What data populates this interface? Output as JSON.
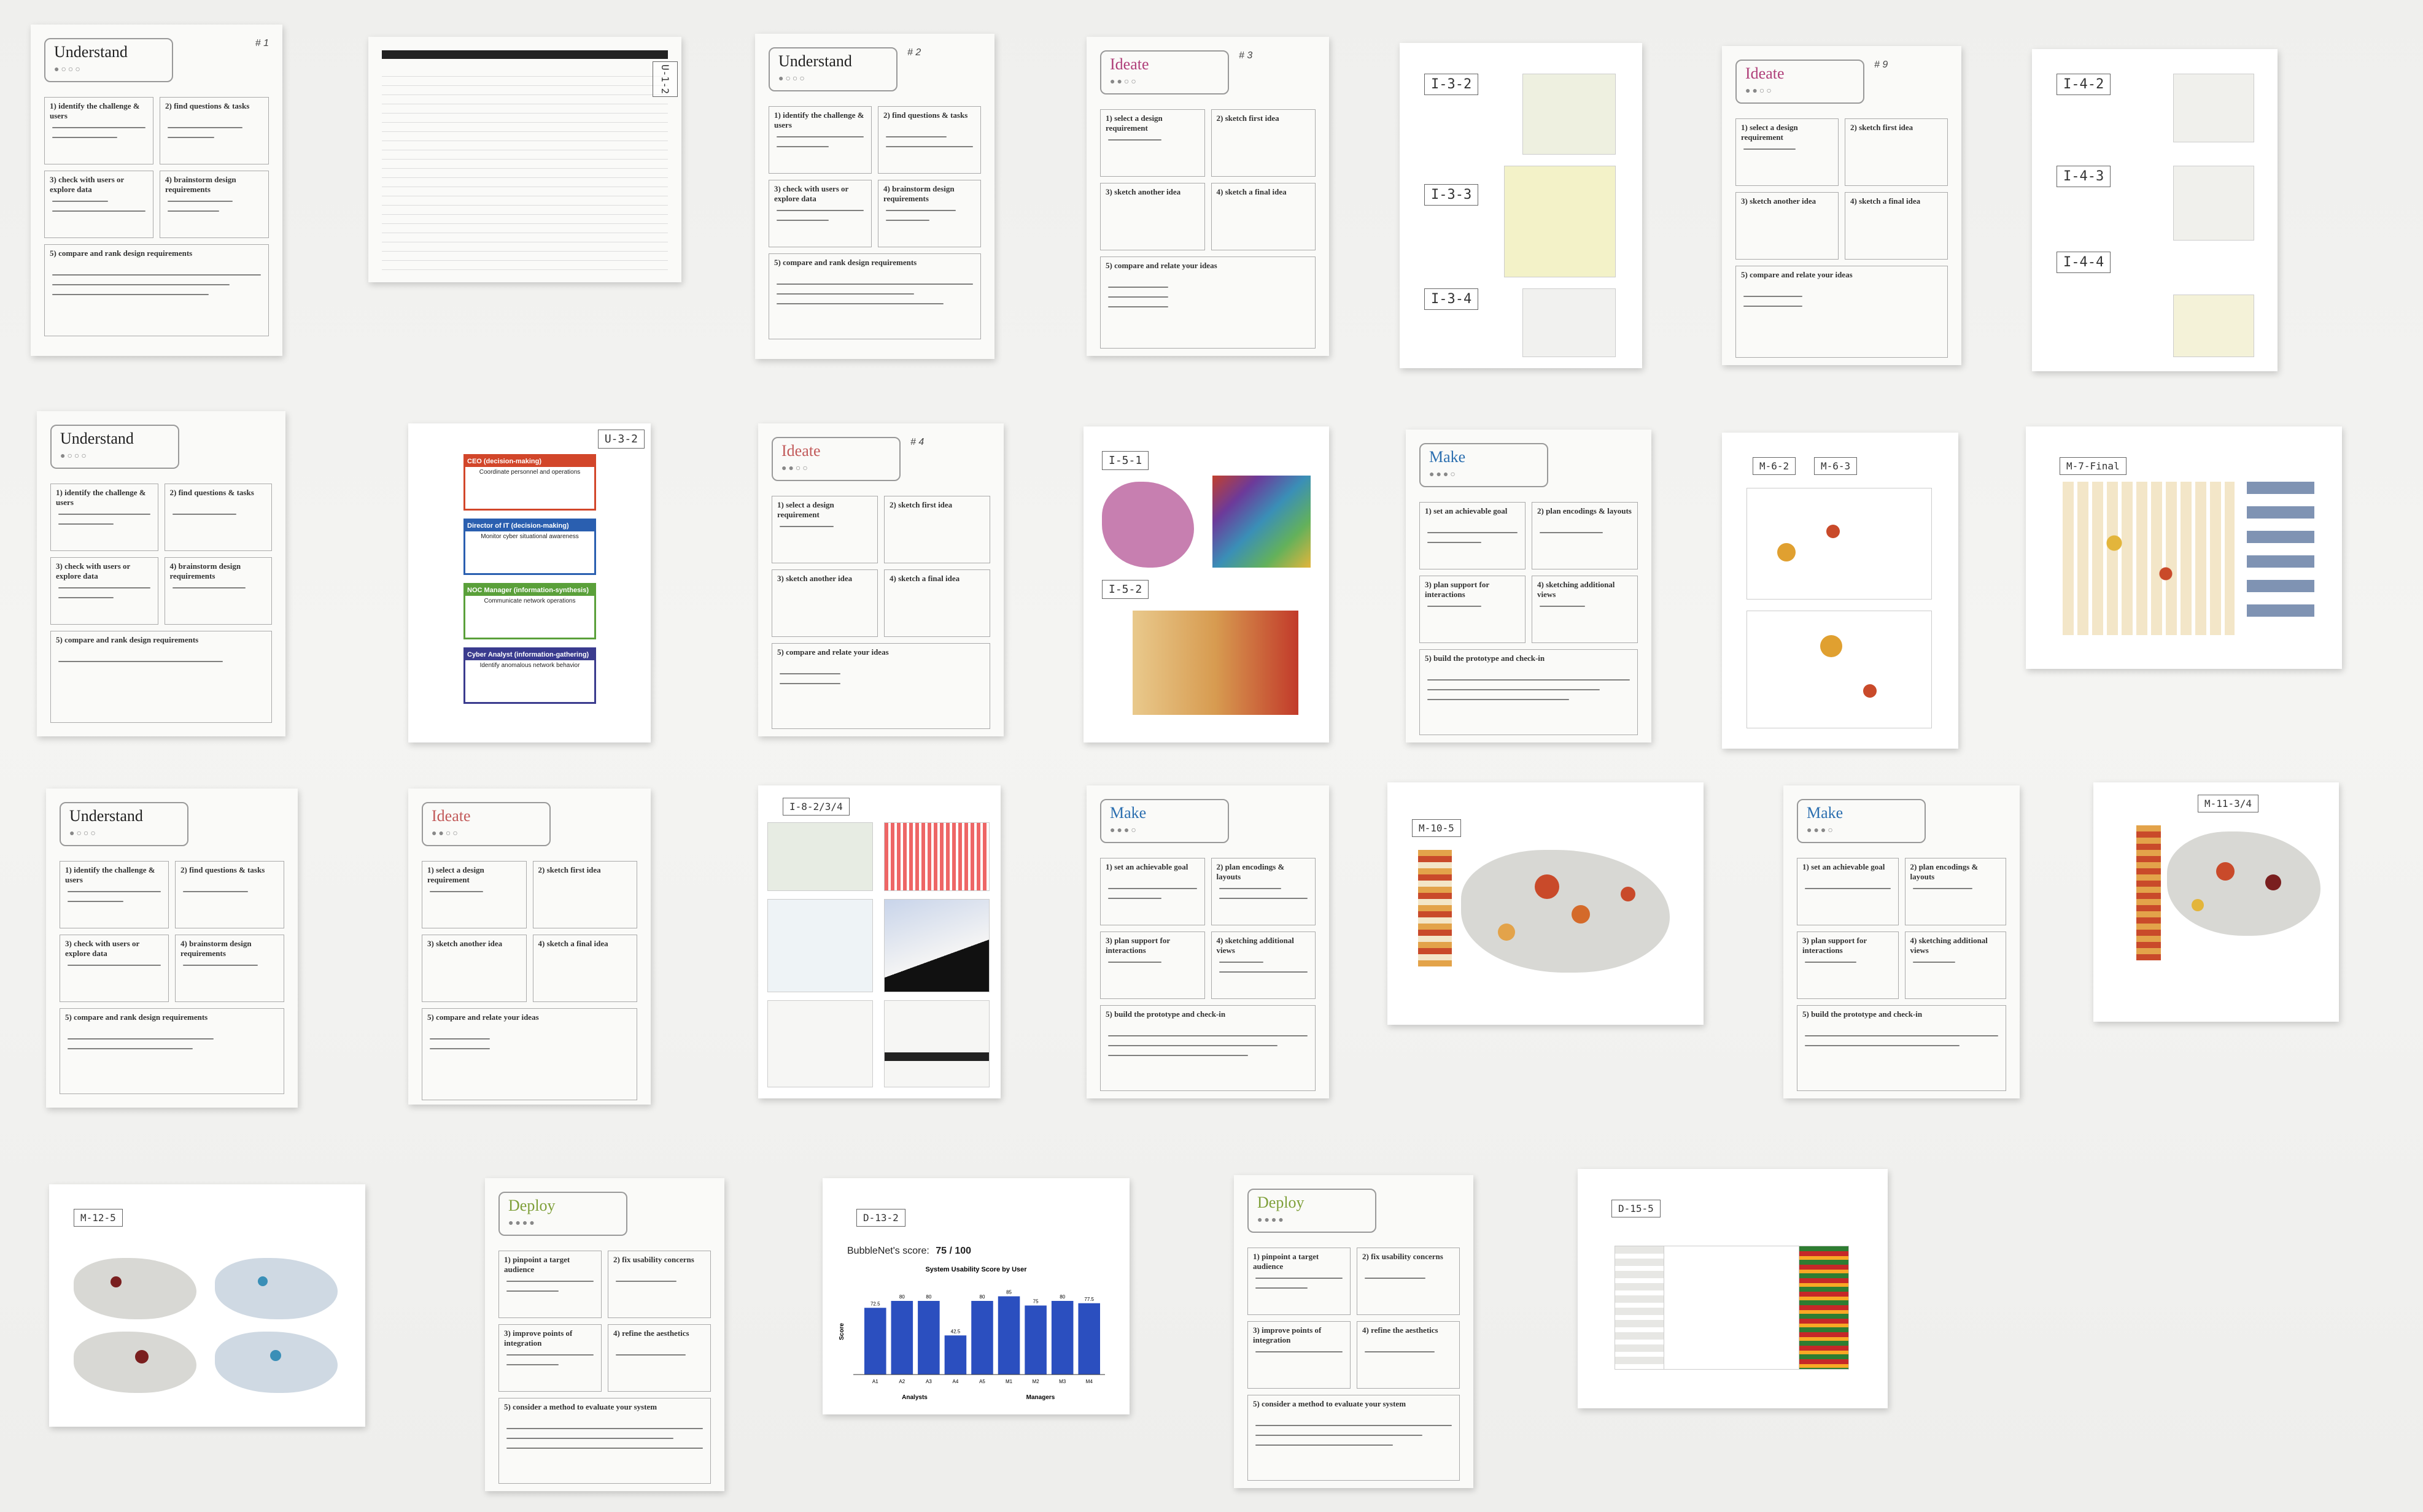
{
  "scene": "wall",
  "sheets": {
    "understand_1": {
      "phase": "Understand",
      "page": "# 1",
      "labels": [
        "1) identify the challenge & users",
        "2) find questions & tasks",
        "3) check with users or explore data",
        "4) brainstorm design requirements",
        "5) compare and rank design requirements"
      ]
    },
    "understand_2": {
      "phase": "Understand",
      "page": "# 2",
      "labels": [
        "1) identify the challenge & users",
        "2) find questions & tasks",
        "3) check with users or explore data",
        "4) brainstorm design requirements",
        "5) compare and rank design requirements"
      ]
    },
    "understand_3": {
      "phase": "Understand",
      "labels": [
        "1) identify the challenge & users",
        "2) find questions & tasks",
        "3) check with users or explore data",
        "4) brainstorm design requirements",
        "5) compare and rank design requirements"
      ]
    },
    "understand_4": {
      "phase": "Understand",
      "labels": [
        "1) identify the challenge & users",
        "2) find questions & tasks",
        "3) check with users or explore data",
        "4) brainstorm design requirements",
        "5) compare and rank design requirements"
      ]
    },
    "ideate_1": {
      "phase": "Ideate",
      "page": "# 3",
      "labels": [
        "1) select a design requirement",
        "2) sketch first idea",
        "3) sketch another idea",
        "4) sketch a final idea",
        "5) compare and relate your ideas"
      ]
    },
    "ideate_2": {
      "phase": "Ideate",
      "page": "# 4",
      "labels": [
        "1) select a design requirement",
        "2) sketch first idea",
        "3) sketch another idea",
        "4) sketch a final idea",
        "5) compare and relate your ideas"
      ]
    },
    "ideate_3": {
      "phase": "Ideate",
      "labels": [
        "1) select a design requirement",
        "2) sketch first idea",
        "3) sketch another idea",
        "4) sketch a final idea",
        "5) compare and relate your ideas"
      ]
    },
    "ideate_4": {
      "phase": "Ideate",
      "page": "# 9",
      "labels": [
        "1) select a design requirement",
        "2) sketch first idea",
        "3) sketch another idea",
        "4) sketch a final idea",
        "5) compare and relate your ideas"
      ]
    },
    "make_1": {
      "phase": "Make",
      "labels": [
        "1) set an achievable goal",
        "2) plan encodings & layouts",
        "3) plan support for interactions",
        "4) sketching additional views",
        "5) build the prototype and check-in"
      ]
    },
    "make_2": {
      "phase": "Make",
      "labels": [
        "1) set an achievable goal",
        "2) plan encodings & layouts",
        "3) plan support for interactions",
        "4) sketching additional views",
        "5) build the prototype and check-in"
      ]
    },
    "make_3": {
      "phase": "Make",
      "labels": [
        "1) set an achievable goal",
        "2) plan encodings & layouts",
        "3) plan support for interactions",
        "4) sketching additional views",
        "5) build the prototype and check-in"
      ]
    },
    "deploy_1": {
      "phase": "Deploy",
      "labels": [
        "1) pinpoint a target audience",
        "2) fix usability concerns",
        "3) improve points of integration",
        "4) refine the aesthetics",
        "5) consider a method to evaluate your system"
      ]
    },
    "deploy_2": {
      "phase": "Deploy",
      "labels": [
        "1) pinpoint a target audience",
        "2) fix usability concerns",
        "3) improve points of integration",
        "4) refine the aesthetics",
        "5) consider a method to evaluate your system"
      ]
    }
  },
  "tags": {
    "t1": "U-1-2",
    "t2": "I-3-2",
    "t3": "I-3-3",
    "t4": "I-3-4",
    "t5": "I-4-2",
    "t6": "I-4-3",
    "t7": "I-4-4",
    "t8": "U-3-2",
    "t9": "I-5-1",
    "t10": "I-5-2",
    "t11": "M-6-2",
    "t12": "M-6-3",
    "t13": "M-7-Final",
    "t14": "I-8-2/3/4",
    "t15": "M-10-5",
    "t16": "M-11-3/4",
    "t17": "M-12-5",
    "t18": "D-13-2",
    "t19": "D-15-5"
  },
  "roles": {
    "r1": "CEO (decision-making)",
    "r1s": "Coordinate personnel and operations",
    "r2": "Director of IT (decision-making)",
    "r2s": "Monitor cyber situational awareness",
    "r3": "NOC Manager (information-synthesis)",
    "r3s": "Communicate network operations",
    "r4": "Cyber Analyst (information-gathering)",
    "r4s": "Identify anomalous network behavior"
  },
  "sus": {
    "score_label": "BubbleNet's score:",
    "score_value": "75 / 100",
    "subtitle": "System Usability Score by User"
  },
  "chart_data": {
    "type": "bar",
    "title": "System Usability Score by User",
    "categories": [
      "A1",
      "A2",
      "A3",
      "A4",
      "A5",
      "M1",
      "M2",
      "M3",
      "M4"
    ],
    "values": [
      72.5,
      80,
      80,
      42.5,
      80,
      85,
      75,
      80,
      77.5
    ],
    "ylabel": "Score",
    "group_labels": [
      "Analysts",
      "Managers"
    ],
    "ylim": [
      0,
      100
    ]
  }
}
